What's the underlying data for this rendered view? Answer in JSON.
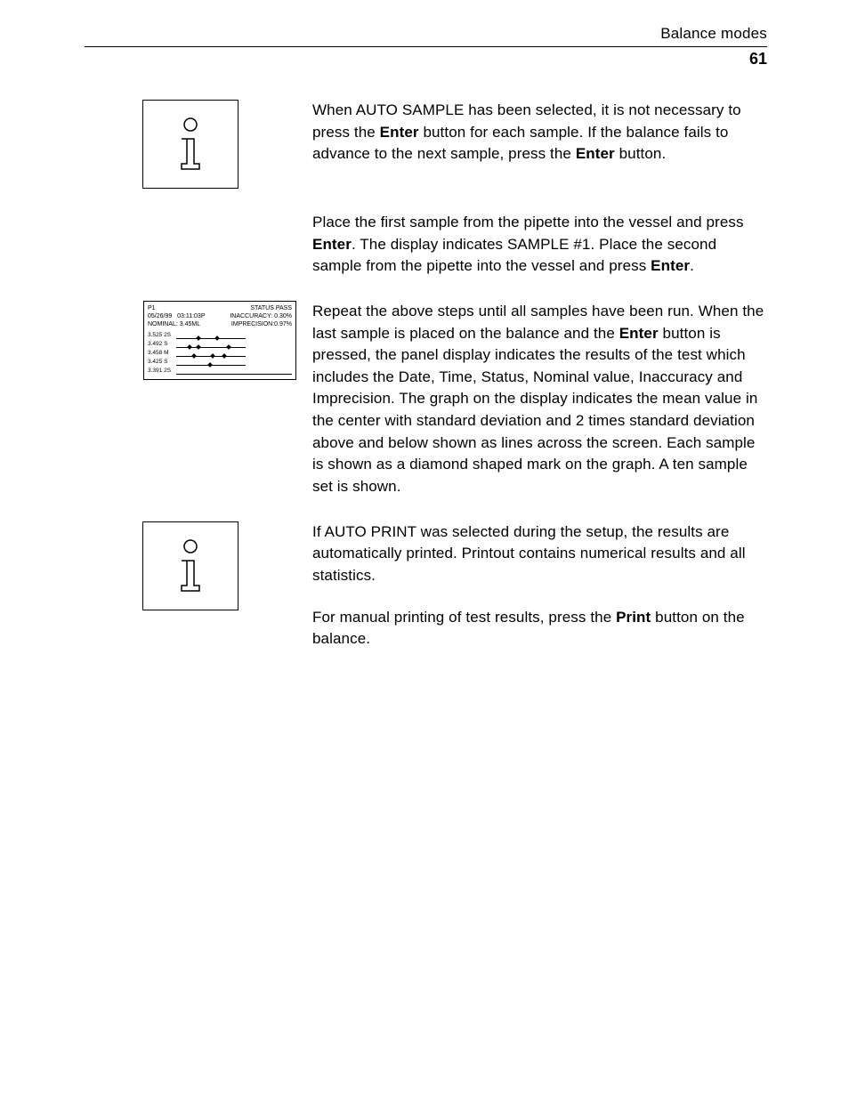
{
  "header": {
    "title": "Balance modes",
    "page_number": "61"
  },
  "paragraphs": {
    "p1_a": "When AUTO SAMPLE has been selected, it is not necessary to press the ",
    "p1_b": "Enter",
    "p1_c": " button for each sample. If the balance fails to advance to the next sample, press the ",
    "p1_d": "Enter",
    "p1_e": " button.",
    "p2_a": "Place the first sample from the pipette into the vessel and press ",
    "p2_b": "Enter",
    "p2_c": ". The display indicates SAMPLE #1. Place the second sample from the pipette into the vessel and press ",
    "p2_d": "Enter",
    "p2_e": ".",
    "p3_a": "Repeat the above steps until all samples have been run. When the last sample is placed on the balance and the ",
    "p3_b": "Enter",
    "p3_c": " button is pressed, the panel display indicates the results of the test which includes the Date, Time, Status, Nominal value, Inaccuracy and Imprecision. The graph on the display indicates the mean value in the center with standard deviation and 2 times standard deviation above and below shown as lines across the screen. Each sample is shown as a diamond shaped mark on the graph. A ten sample set is shown.",
    "p4": "If AUTO PRINT was selected during the setup, the results are automatically printed. Printout contains numerical results and all statistics.",
    "p5_a": "For manual printing of test results, press the ",
    "p5_b": "Print",
    "p5_c": " button on the balance."
  },
  "display": {
    "p1": "P1",
    "status": "STATUS PASS",
    "date": "05/26/99",
    "time": "03:11:03P",
    "inaccuracy": "INACCURACY: 0.30%",
    "nominal": "NOMINAL: 3.45ML",
    "imprecision": "IMPRECISION:0.97%",
    "rows": [
      {
        "label": "3.525   2S",
        "diamonds": [
          18,
          34
        ],
        "short": true
      },
      {
        "label": "3.492   S",
        "diamonds": [
          10,
          18,
          44
        ],
        "short": true
      },
      {
        "label": "3.458   M",
        "diamonds": [
          14,
          30,
          40
        ],
        "short": true
      },
      {
        "label": "3.425   S",
        "diamonds": [
          28
        ],
        "short": true
      },
      {
        "label": "3.391   2S",
        "diamonds": [],
        "short": false
      }
    ]
  }
}
